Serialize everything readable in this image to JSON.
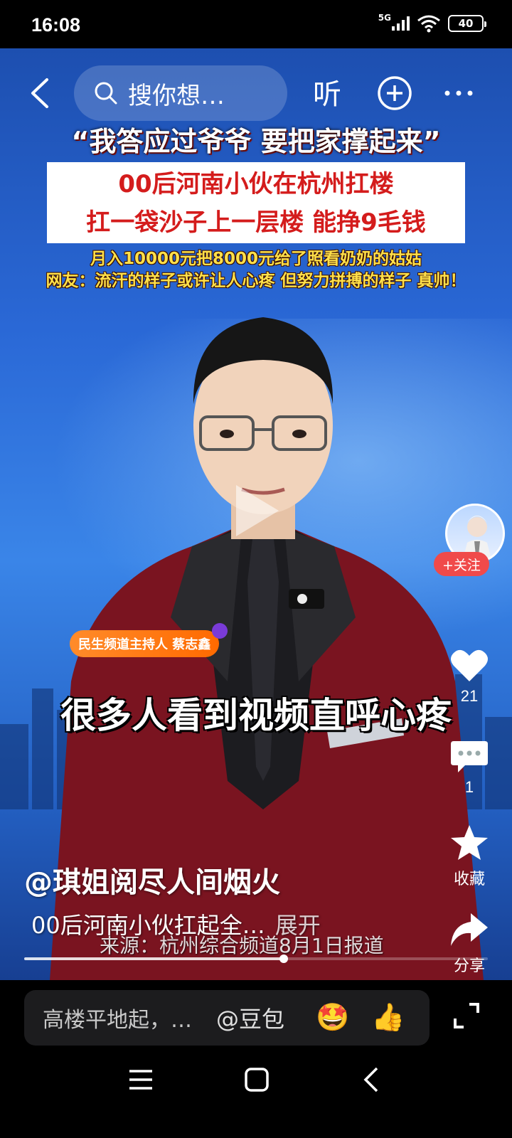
{
  "status": {
    "time": "16:08",
    "network": "5G",
    "battery": "40"
  },
  "topnav": {
    "search_placeholder": "搜你想…",
    "listen_label": "听"
  },
  "overlay": {
    "quote": "“我答应过爷爷 要把家撑起来”",
    "red_line1": "00后河南小伙在杭州扛楼",
    "red_line2": "扛一袋沙子上一层楼 能挣9毛钱",
    "yellow_line1": "月入10000元把8000元给了照看奶奶的姑姑",
    "yellow_line2": "网友：流汗的样子或许让人心疼 但努力拼搏的样子 真帅！",
    "name_tag": "民生频道主持人 蔡志鑫",
    "caption": "很多人看到视频直呼心疼",
    "source": "来源：杭州综合频道8月1日报道"
  },
  "side": {
    "follow_label": "+关注",
    "like_count": "21",
    "comment_count": "1",
    "favorite_label": "收藏",
    "share_label": "分享"
  },
  "post": {
    "author": "@琪姐阅尽人间烟火",
    "description": "00后河南小伙扛起全…",
    "expand_label": "展开",
    "progress": 0.56
  },
  "bottom": {
    "comment_placeholder": "高楼平地起，…",
    "mention": "@豆包",
    "emoji1": "🤩",
    "emoji2": "👍"
  }
}
